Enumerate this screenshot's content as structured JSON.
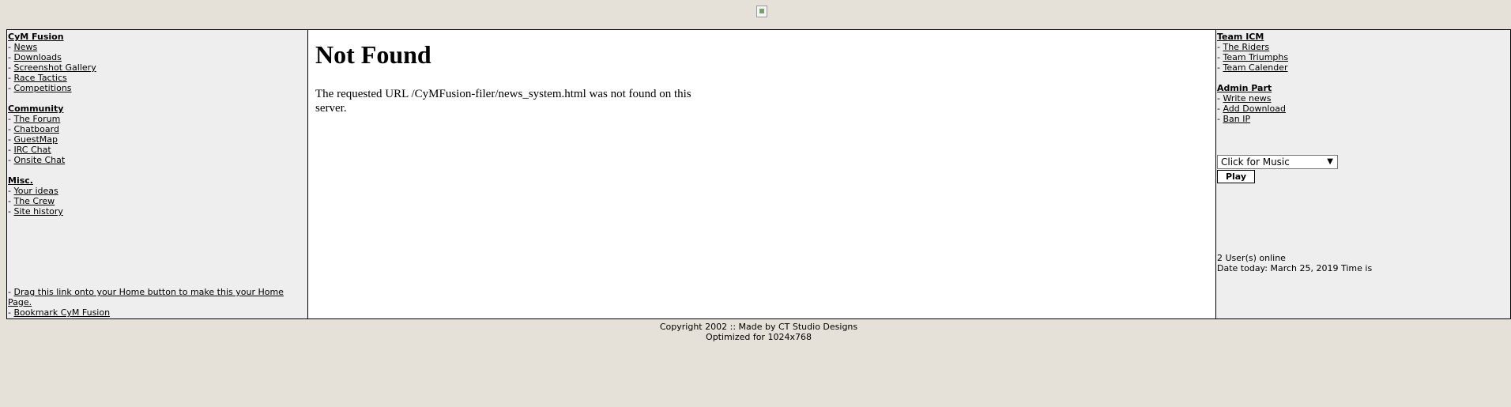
{
  "left": {
    "fusion_title": "CyM Fusion",
    "fusion_links": [
      "News",
      "Downloads",
      "Screenshot Gallery",
      "Race Tactics",
      "Competitions"
    ],
    "community_title": "Community",
    "community_links": [
      "The Forum",
      "Chatboard",
      "GuestMap",
      "IRC Chat",
      "Onsite Chat"
    ],
    "misc_title": "Misc.",
    "misc_links": [
      "Your ideas",
      "The Crew",
      "Site history"
    ],
    "home_link": "Drag this link onto your Home button to make this your Home Page.",
    "bookmark_link": "Bookmark CyM Fusion"
  },
  "main": {
    "title": "Not Found",
    "message": "The requested URL /CyMFusion-filer/news_system.html was not found on this server."
  },
  "right": {
    "team_title": "Team ICM",
    "team_links": [
      "The Riders",
      "Team Triumphs",
      "Team Calender"
    ],
    "admin_title": "Admin Part",
    "admin_links": [
      "Write news",
      "Add Download",
      "Ban IP"
    ],
    "music_select_value": "Click for Music",
    "play_label": "Play",
    "users_online": "2 User(s) online",
    "date_today": "Date today: March 25, 2019 Time is"
  },
  "footer": {
    "line1": "Copyright 2002 :: Made by CT Studio Designs",
    "line2": "Optimized for 1024x768"
  }
}
